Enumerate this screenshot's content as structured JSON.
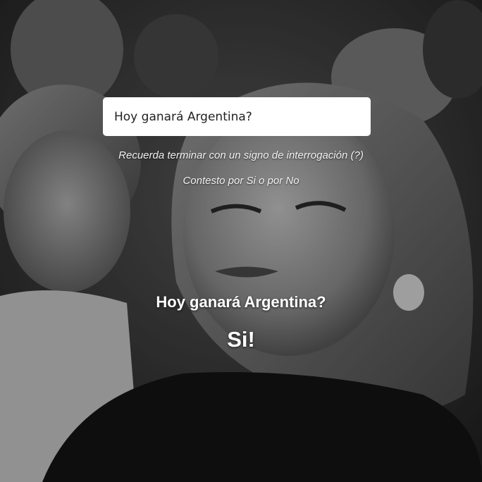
{
  "question_input": {
    "value": "Hoy ganará Argentina?"
  },
  "hints": {
    "line1": "Recuerda terminar con un signo de interrogación (?)",
    "line2": "Contesto por Si o por No"
  },
  "result": {
    "question": "Hoy ganará Argentina?",
    "answer": "Si!"
  },
  "background": {
    "image_name": "reaction-gif-background",
    "tone": "grayscale"
  }
}
